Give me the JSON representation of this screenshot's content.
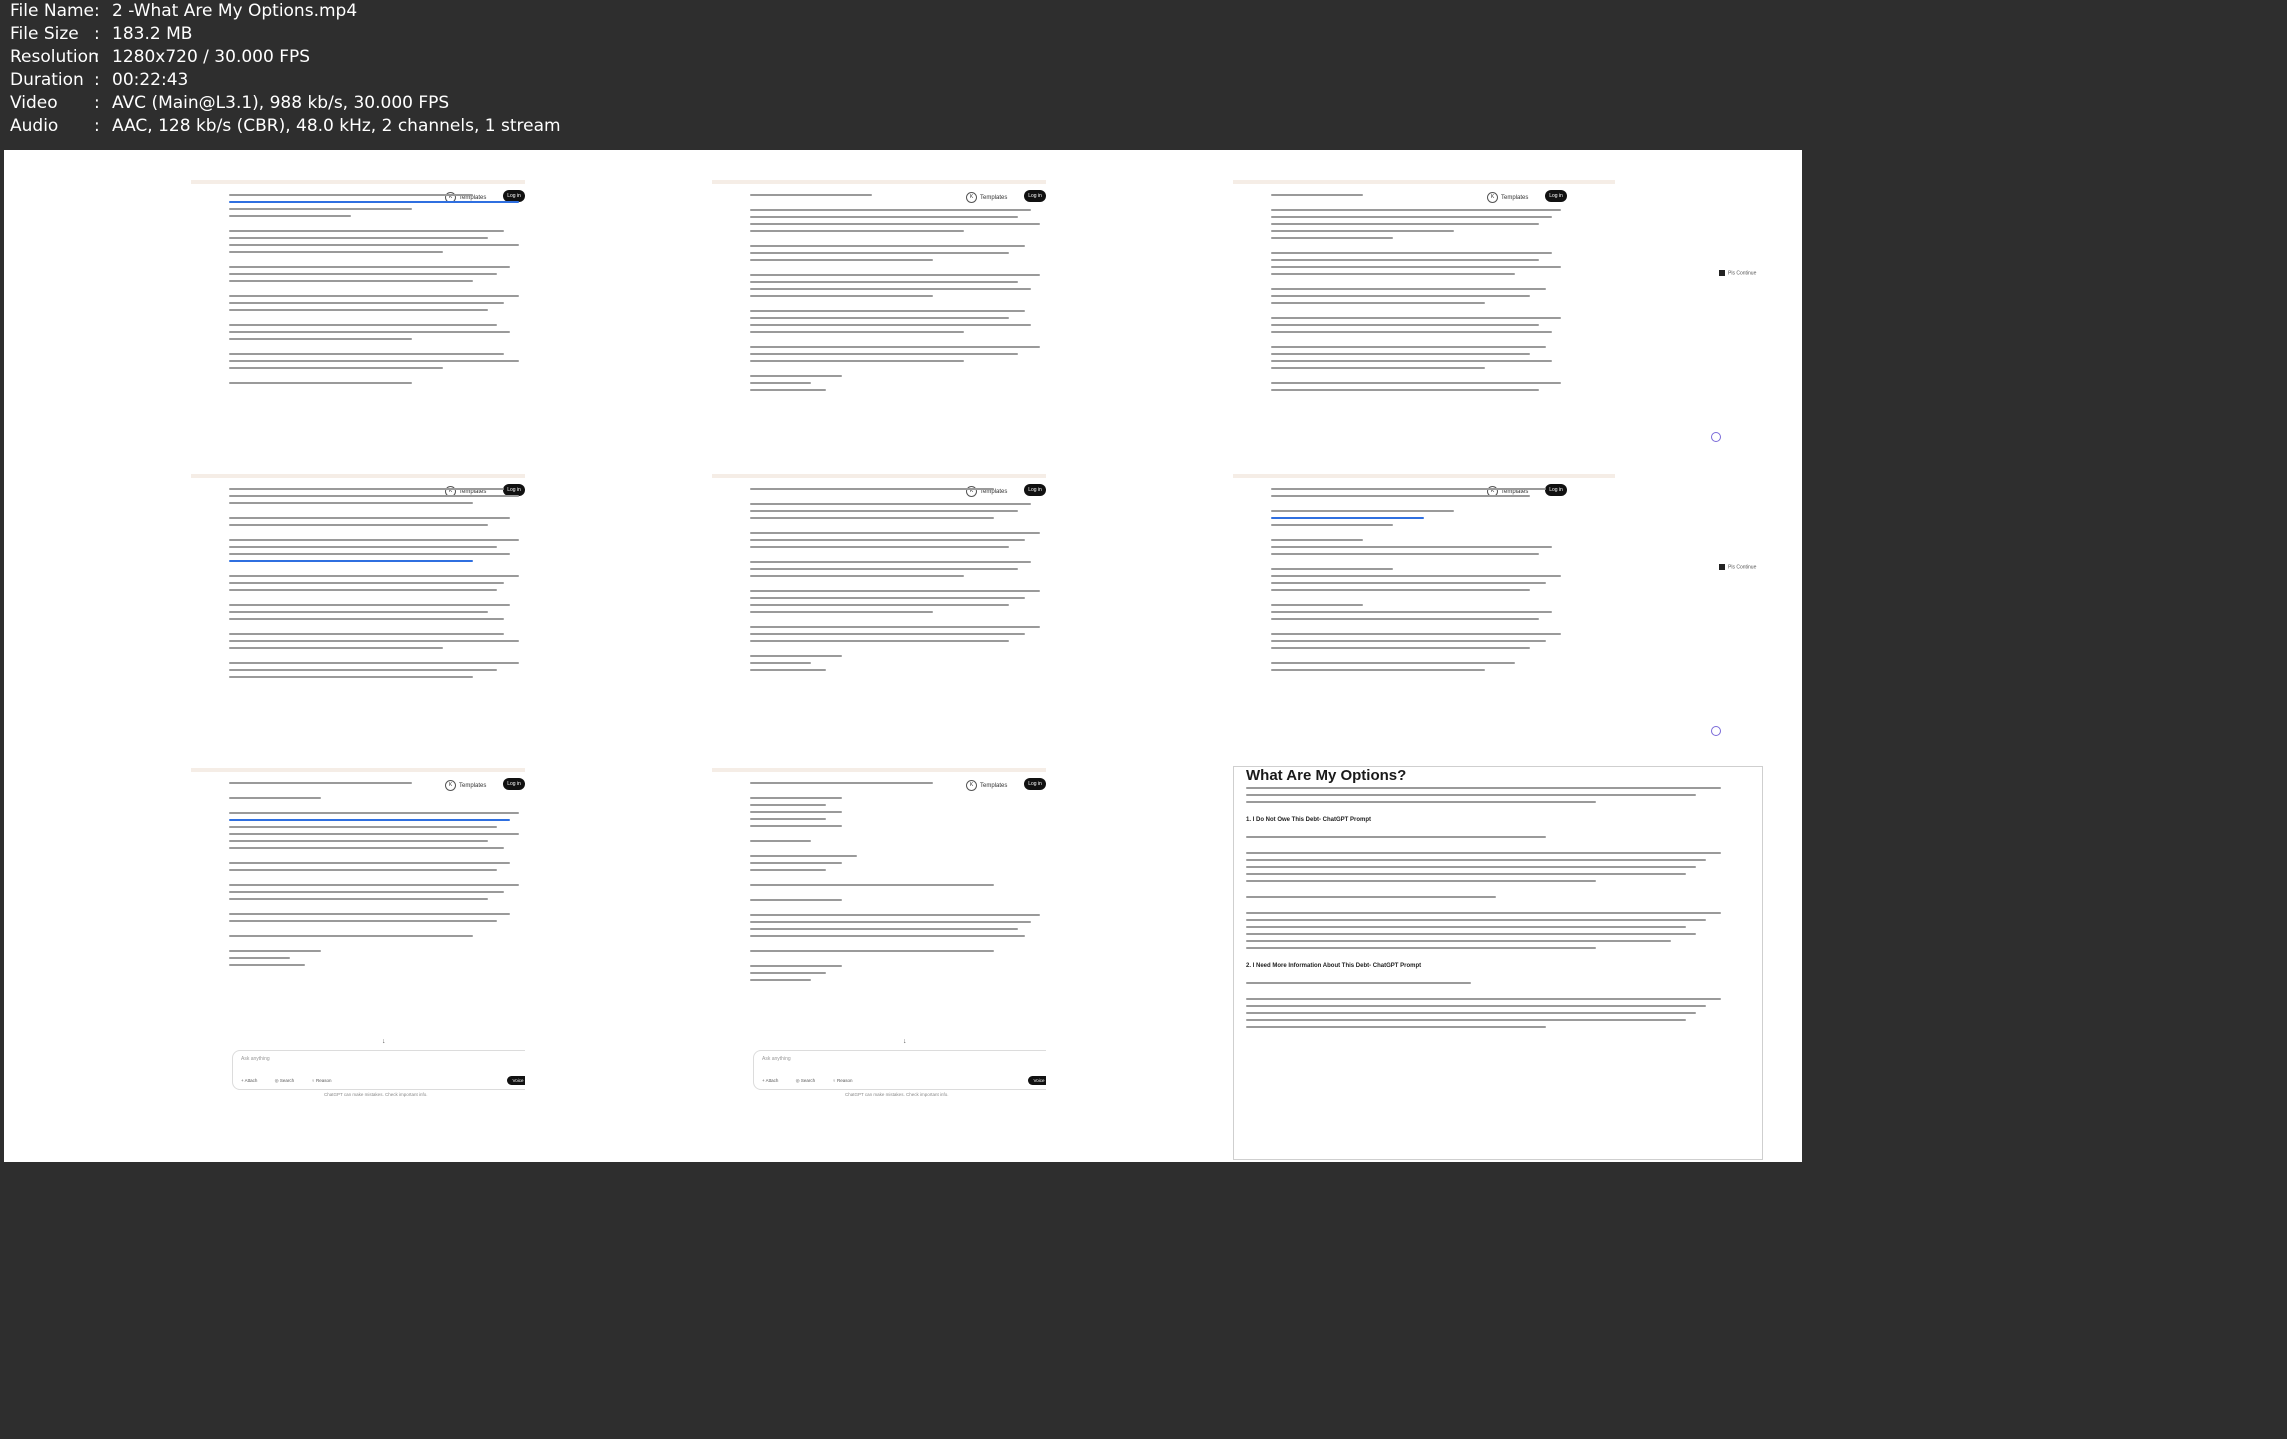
{
  "file_info": [
    {
      "label": "File Name",
      "value": "2 -What Are My Options.mp4"
    },
    {
      "label": "File Size",
      "value": "183.2 MB"
    },
    {
      "label": "Resolution",
      "value": "1280x720 / 30.000 FPS"
    },
    {
      "label": "Duration",
      "value": "00:22:43"
    },
    {
      "label": "Video",
      "value": "AVC (Main@L3.1), 988 kb/s, 30.000 FPS"
    },
    {
      "label": "Audio",
      "value": "AAC, 128 kb/s (CBR), 48.0 kHz, 2 channels, 1 stream"
    }
  ],
  "ui": {
    "templates_label": "Templates",
    "login_label": "Log in",
    "continue_label": "Pls Continue",
    "chat_placeholder": "Ask anything",
    "attach_label": "Attach",
    "search_label": "Search",
    "reason_label": "Reason",
    "voice_label": "Voice",
    "disclaimer": "ChatGPT can make mistakes. Check important info."
  },
  "last_thumb": {
    "title": "What Are My Options?",
    "heading1": "1. I Do Not Owe This Debt- ChatGPT Prompt",
    "heading2": "2. I Need More Information About This Debt- ChatGPT Prompt"
  },
  "colors": {
    "background": "#2e2e2e",
    "highlight": "#2f6fe0"
  }
}
